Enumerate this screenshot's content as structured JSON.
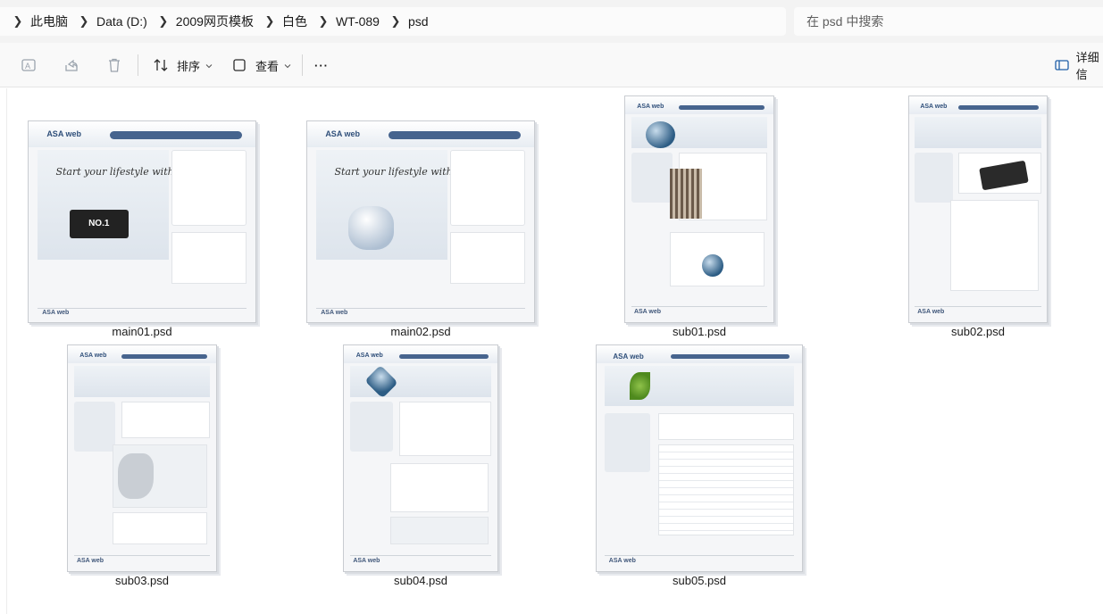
{
  "breadcrumb": {
    "items": [
      "此电脑",
      "Data (D:)",
      "2009网页模板",
      "白色",
      "WT-089",
      "psd"
    ]
  },
  "search": {
    "placeholder": "在 psd 中搜索"
  },
  "toolbar": {
    "sort_label": "排序",
    "view_label": "查看",
    "more_label": "···",
    "details_label": "详细信"
  },
  "files": [
    {
      "name": "main01.psd",
      "logo": "ASA web",
      "footer_logo": "ASA web",
      "badge": "NO.1"
    },
    {
      "name": "main02.psd",
      "logo": "ASA web",
      "footer_logo": "ASA web"
    },
    {
      "name": "sub01.psd",
      "logo": "ASA web",
      "footer_logo": "ASA web"
    },
    {
      "name": "sub02.psd",
      "logo": "ASA web",
      "footer_logo": "ASA web"
    },
    {
      "name": "sub03.psd",
      "logo": "ASA web",
      "footer_logo": "ASA web"
    },
    {
      "name": "sub04.psd",
      "logo": "ASA web",
      "footer_logo": "ASA web"
    },
    {
      "name": "sub05.psd",
      "logo": "ASA web",
      "footer_logo": "ASA web"
    }
  ],
  "colors": {
    "accent_nav": "#46648e",
    "titlebar_bg": "#f3f3f3",
    "toolbar_bg": "#f9f9f9"
  }
}
